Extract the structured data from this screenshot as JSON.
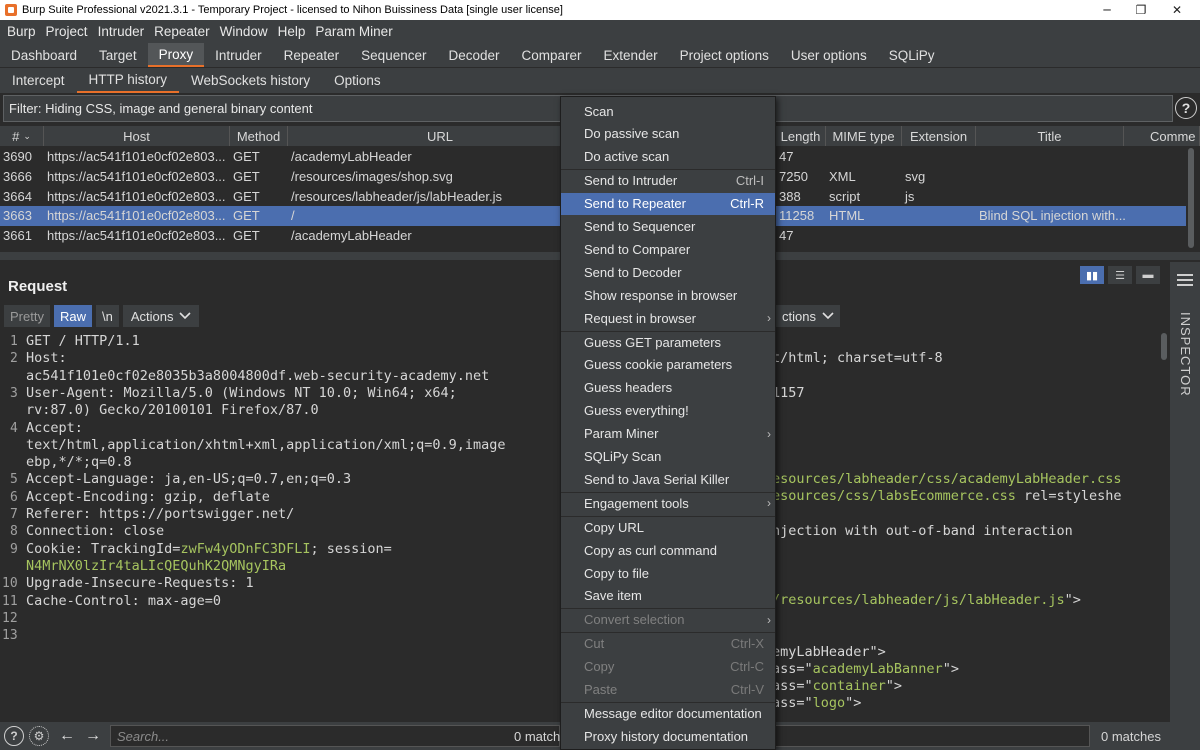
{
  "window": {
    "title": "Burp Suite Professional v2021.3.1 - Temporary Project - licensed to Nihon Buissiness Data [single user license]"
  },
  "menubar": [
    "Burp",
    "Project",
    "Intruder",
    "Repeater",
    "Window",
    "Help",
    "Param Miner"
  ],
  "main_tabs": [
    "Dashboard",
    "Target",
    "Proxy",
    "Intruder",
    "Repeater",
    "Sequencer",
    "Decoder",
    "Comparer",
    "Extender",
    "Project options",
    "User options",
    "SQLiPy"
  ],
  "active_main_tab": "Proxy",
  "sub_tabs": [
    "Intercept",
    "HTTP history",
    "WebSockets history",
    "Options"
  ],
  "active_sub_tab": "HTTP history",
  "filter_text": "Filter: Hiding CSS, image and general binary content",
  "table": {
    "headers": {
      "num": "#",
      "host": "Host",
      "method": "Method",
      "url": "URL",
      "length": "Length",
      "mime": "MIME type",
      "ext": "Extension",
      "title": "Title",
      "comment": "Comme"
    },
    "rows": [
      {
        "num": "3690",
        "host": "https://ac541f101e0cf02e803...",
        "method": "GET",
        "url": "/academyLabHeader",
        "length": "47",
        "mime": "",
        "ext": "",
        "title": ""
      },
      {
        "num": "3666",
        "host": "https://ac541f101e0cf02e803...",
        "method": "GET",
        "url": "/resources/images/shop.svg",
        "length": "7250",
        "mime": "XML",
        "ext": "svg",
        "title": ""
      },
      {
        "num": "3664",
        "host": "https://ac541f101e0cf02e803...",
        "method": "GET",
        "url": "/resources/labheader/js/labHeader.js",
        "length": "388",
        "mime": "script",
        "ext": "js",
        "title": ""
      },
      {
        "num": "3663",
        "host": "https://ac541f101e0cf02e803...",
        "method": "GET",
        "url": "/",
        "length": "11258",
        "mime": "HTML",
        "ext": "",
        "title": "Blind SQL injection with..."
      },
      {
        "num": "3661",
        "host": "https://ac541f101e0cf02e803...",
        "method": "GET",
        "url": "/academyLabHeader",
        "length": "47",
        "mime": "",
        "ext": "",
        "title": ""
      }
    ],
    "selected_row": "3663"
  },
  "request": {
    "title": "Request",
    "toolbar": {
      "pretty": "Pretty",
      "raw": "Raw",
      "newline": "\\n",
      "actions": "Actions"
    },
    "lines": [
      {
        "n": "1",
        "text": "GET / HTTP/1.1"
      },
      {
        "n": "2",
        "text": "Host:"
      },
      {
        "n": "",
        "text": "ac541f101e0cf02e8035b3a8004800df.web-security-academy.net"
      },
      {
        "n": "3",
        "text": "User-Agent: Mozilla/5.0 (Windows NT 10.0; Win64; x64;"
      },
      {
        "n": "",
        "text": "rv:87.0) Gecko/20100101 Firefox/87.0"
      },
      {
        "n": "4",
        "text": "Accept:"
      },
      {
        "n": "",
        "text": "text/html,application/xhtml+xml,application/xml;q=0.9,image"
      },
      {
        "n": "",
        "text": "ebp,*/*;q=0.8"
      },
      {
        "n": "5",
        "text": "Accept-Language: ja,en-US;q=0.7,en;q=0.3"
      },
      {
        "n": "6",
        "text": "Accept-Encoding: gzip, deflate"
      },
      {
        "n": "7",
        "text": "Referer: https://portswigger.net/"
      },
      {
        "n": "8",
        "text": "Connection: close"
      }
    ],
    "cookie": {
      "n": "9",
      "prefix": "Cookie: TrackingId=",
      "tracking": "zwFw4yODnFC3DFLI",
      "mid": "; session=",
      "session": "N4MrNX0lzIr4taLIcQEQuhK2QMNgyIRa"
    },
    "lines_after": [
      {
        "n": "10",
        "text": "Upgrade-Insecure-Requests: 1"
      },
      {
        "n": "11",
        "text": "Cache-Control: max-age=0"
      },
      {
        "n": "12",
        "text": ""
      },
      {
        "n": "13",
        "text": ""
      }
    ]
  },
  "response": {
    "actions": "ctions",
    "fragments": [
      {
        "text": "t/html; charset=utf-8",
        "str": ""
      },
      {
        "text": "1157",
        "str": ""
      },
      {
        "text": "",
        "str": "esources/labheader/css/academyLabHeader.css"
      },
      {
        "text": "",
        "str": "esources/css/labsEcommerce.css",
        "tail": " rel=styleshe"
      },
      {
        "text": "njection with out-of-band interaction",
        "str": ""
      },
      {
        "text": "",
        "str": "/resources/labheader/js/labHeader.js",
        "tail": "\">"
      },
      {
        "text": "emyLabHeader\">",
        "str": ""
      },
      {
        "text": "ass=\"",
        "str": "academyLabBanner",
        "tail": "\">"
      },
      {
        "text": "ass=\"",
        "str": "container",
        "tail": "\">"
      },
      {
        "text": "ass=\"",
        "str": "logo",
        "tail": "\">"
      }
    ]
  },
  "inspector_label": "INSPECTOR",
  "bottom": {
    "search_placeholder": "Search...",
    "matches_left": "0 match",
    "matches_right": "0 matches"
  },
  "context_menu": {
    "items": [
      {
        "label": "Scan"
      },
      {
        "label": "Do passive scan"
      },
      {
        "label": "Do active scan"
      },
      {
        "sep": true
      },
      {
        "label": "Send to Intruder",
        "shortcut": "Ctrl-I"
      },
      {
        "label": "Send to Repeater",
        "shortcut": "Ctrl-R",
        "highlighted": true
      },
      {
        "label": "Send to Sequencer"
      },
      {
        "label": "Send to Comparer"
      },
      {
        "label": "Send to Decoder"
      },
      {
        "label": "Show response in browser"
      },
      {
        "label": "Request in browser",
        "submenu": true
      },
      {
        "sep": true
      },
      {
        "label": "Guess GET parameters"
      },
      {
        "label": "Guess cookie parameters"
      },
      {
        "label": "Guess headers"
      },
      {
        "label": "Guess everything!"
      },
      {
        "label": "Param Miner",
        "submenu": true
      },
      {
        "label": "SQLiPy Scan"
      },
      {
        "label": "Send to Java Serial Killer"
      },
      {
        "sep": true
      },
      {
        "label": "Engagement tools",
        "submenu": true
      },
      {
        "sep": true
      },
      {
        "label": "Copy URL"
      },
      {
        "label": "Copy as curl command"
      },
      {
        "label": "Copy to file"
      },
      {
        "label": "Save item"
      },
      {
        "sep": true
      },
      {
        "label": "Convert selection",
        "submenu": true,
        "disabled": true
      },
      {
        "sep": true
      },
      {
        "label": "Cut",
        "shortcut": "Ctrl-X",
        "disabled": true
      },
      {
        "label": "Copy",
        "shortcut": "Ctrl-C",
        "disabled": true
      },
      {
        "label": "Paste",
        "shortcut": "Ctrl-V",
        "disabled": true
      },
      {
        "sep": true
      },
      {
        "label": "Message editor documentation"
      },
      {
        "label": "Proxy history documentation"
      }
    ]
  },
  "colors": {
    "accent": "#e8702a",
    "selection": "#4b6eaf",
    "string": "#a6c45f"
  }
}
